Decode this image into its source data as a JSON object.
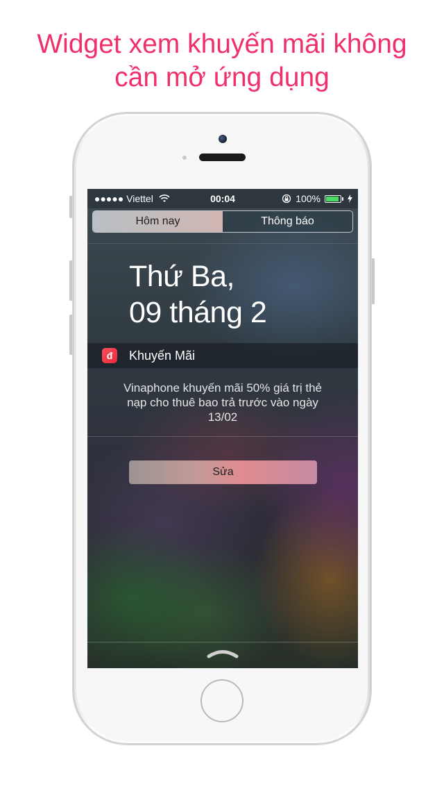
{
  "headline": {
    "line1": "Widget xem khuyến mãi không",
    "line2": "cần mở ứng dụng"
  },
  "status_bar": {
    "carrier": "●●●●● Viettel",
    "time": "00:04",
    "battery_percent": "100%",
    "battery_color": "#4cd964"
  },
  "segments": [
    {
      "label": "Hôm nay",
      "active": true
    },
    {
      "label": "Thông báo",
      "active": false
    }
  ],
  "today": {
    "weekday": "Thứ Ba,",
    "date": "09 tháng 2"
  },
  "widget": {
    "icon_glyph": "đ",
    "icon_name": "dong-sign-icon",
    "title": "Khuyến Mãi",
    "message_line1": "Vinaphone khuyến mãi 50% giá trị thẻ",
    "message_line2": "nạp cho thuê bao trả trước vào ngày",
    "message_line3": "13/02"
  },
  "edit_button": {
    "label": "Sửa"
  },
  "colors": {
    "headline": "#f0306a",
    "app_icon": "#ff4f5b"
  }
}
